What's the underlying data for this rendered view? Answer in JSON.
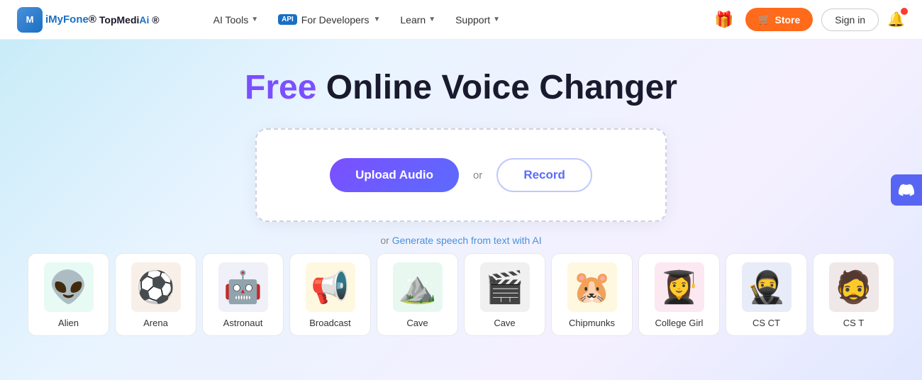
{
  "navbar": {
    "logo_text": "iMyFone",
    "logo_sub_text": "TopMediAi",
    "logo_sub_reg": "®",
    "nav_items": [
      {
        "id": "ai-tools",
        "label": "AI Tools",
        "has_dropdown": true
      },
      {
        "id": "for-developers",
        "label": "For Developers",
        "has_dropdown": true,
        "has_api_badge": true,
        "api_label": "API"
      },
      {
        "id": "learn",
        "label": "Learn",
        "has_dropdown": true
      },
      {
        "id": "support",
        "label": "Support",
        "has_dropdown": true
      }
    ],
    "store_label": "Store",
    "signin_label": "Sign in"
  },
  "hero": {
    "title_free": "Free",
    "title_rest": " Online Voice Changer",
    "upload_btn": "Upload Audio",
    "or_label": "or",
    "record_btn": "Record",
    "generate_text": "or ",
    "generate_link_text": "Generate speech from text with AI"
  },
  "voice_cards": [
    {
      "id": "alien",
      "label": "Alien",
      "emoji": "👽",
      "bg": "#e8faf4",
      "color": "#00b07a"
    },
    {
      "id": "arena",
      "label": "Arena",
      "emoji": "⚽",
      "bg": "#f8f0e8",
      "color": "#c45e1a"
    },
    {
      "id": "astronaut",
      "label": "Astronaut",
      "emoji": "🤖",
      "bg": "#f0f0f8",
      "color": "#7070b0"
    },
    {
      "id": "broadcast",
      "label": "Broadcast",
      "emoji": "📢",
      "bg": "#fff8e0",
      "color": "#e0a000"
    },
    {
      "id": "cave1",
      "label": "Cave",
      "emoji": "⛰️",
      "bg": "#e8f8f0",
      "color": "#00a060"
    },
    {
      "id": "cave2",
      "label": "Cave",
      "emoji": "🎬",
      "bg": "#f0f0f0",
      "color": "#505050"
    },
    {
      "id": "chipmunks",
      "label": "Chipmunks",
      "emoji": "🐹",
      "bg": "#fff8e0",
      "color": "#e0a000"
    },
    {
      "id": "college-girl",
      "label": "College Girl",
      "emoji": "👩‍🎓",
      "bg": "#fce8f0",
      "color": "#e06080"
    },
    {
      "id": "cs-ct",
      "label": "CS CT",
      "emoji": "🥷",
      "bg": "#e8ecf8",
      "color": "#4060b0"
    },
    {
      "id": "cs-t",
      "label": "CS T",
      "emoji": "🧔",
      "bg": "#f0e8e8",
      "color": "#b04040"
    }
  ],
  "discord": {
    "tooltip": "Discord"
  }
}
